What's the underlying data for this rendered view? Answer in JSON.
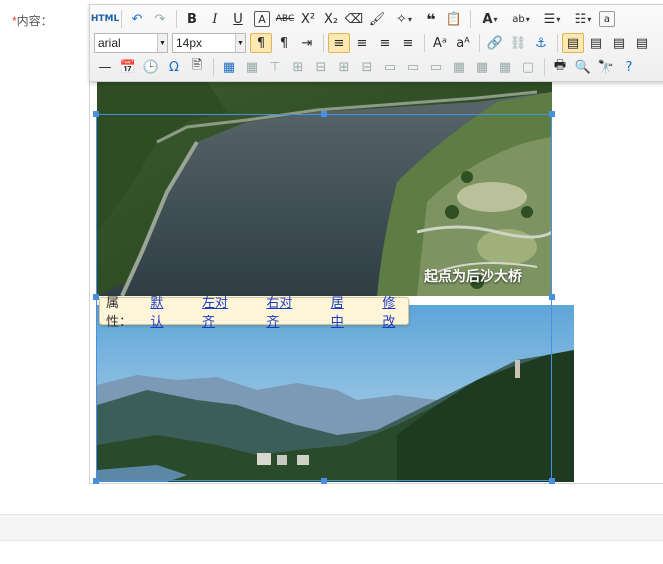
{
  "form": {
    "required_mark": "*",
    "content_label": "内容："
  },
  "toolbar": {
    "html_label": "HTML",
    "font_family": "arial",
    "font_size": "14px"
  },
  "image1": {
    "caption": "起点为后沙大桥"
  },
  "image_popup": {
    "prefix": "属性：",
    "default": "默认",
    "align_left": "左对齐",
    "align_right": "右对齐",
    "align_center": "居中",
    "modify": "修改"
  },
  "colors": {
    "selection": "#4a90e2",
    "popup_bg": "#fff6d9",
    "link": "#1a3cc4",
    "required": "#e4393c"
  }
}
